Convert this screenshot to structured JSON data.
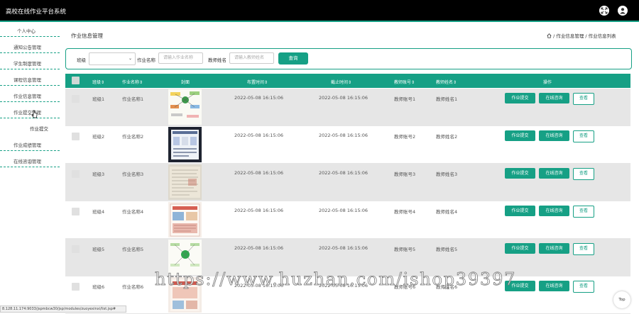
{
  "app": {
    "title": "高校在线作业平台系统"
  },
  "header": {
    "icons": [
      "expand-icon",
      "user-avatar-icon"
    ]
  },
  "sidebar": {
    "items": [
      {
        "label": "个人中心"
      },
      {
        "label": "通知公告管理"
      },
      {
        "label": "学生制度管理"
      },
      {
        "label": "课程信息管理"
      },
      {
        "label": "作业信息管理"
      },
      {
        "label": "作业提交管理"
      },
      {
        "label": "作业成绩管理"
      },
      {
        "label": "在线咨询管理"
      }
    ],
    "submenu": {
      "label": "作业提交"
    }
  },
  "page": {
    "title": "作业信息管理",
    "breadcrumb": "/ 作业信息管理 / 作业信息列表"
  },
  "search": {
    "class_label": "班级",
    "homework_label": "作业名称",
    "homework_placeholder": "请输入作业名称",
    "teacher_label": "教师姓名",
    "teacher_placeholder": "请输入教师姓名",
    "query_button": "查询"
  },
  "table": {
    "columns": [
      "班级⇕",
      "作业名称⇕",
      "封面",
      "布置时间⇕",
      "截止时间⇕",
      "教师账号⇕",
      "教师姓名⇕",
      "操作"
    ],
    "rows": [
      {
        "class": "班级1",
        "name": "作业名称1",
        "assign": "2022-05-08 16:15:06",
        "deadline": "2022-05-08 16:15:06",
        "account": "教师账号1",
        "teacher": "教师姓名1"
      },
      {
        "class": "班级2",
        "name": "作业名称2",
        "assign": "2022-05-08 16:15:06",
        "deadline": "2022-05-08 16:15:06",
        "account": "教师账号2",
        "teacher": "教师姓名2"
      },
      {
        "class": "班级3",
        "name": "作业名称3",
        "assign": "2022-05-08 16:15:06",
        "deadline": "2022-05-08 16:15:06",
        "account": "教师账号3",
        "teacher": "教师姓名3"
      },
      {
        "class": "班级4",
        "name": "作业名称4",
        "assign": "2022-05-08 16:15:06",
        "deadline": "2022-05-08 16:15:06",
        "account": "教师账号4",
        "teacher": "教师姓名4"
      },
      {
        "class": "班级5",
        "name": "作业名称5",
        "assign": "2022-05-08 16:15:06",
        "deadline": "2022-05-08 16:15:06",
        "account": "教师账号5",
        "teacher": "教师姓名5"
      },
      {
        "class": "班级6",
        "name": "作业名称6",
        "assign": "2022-05-08 16:15:06",
        "deadline": "2022-05-08 16:15:06",
        "account": "教师账号6",
        "teacher": "教师姓名6"
      }
    ],
    "actions": {
      "submit": "作业提交",
      "consult": "在线咨询",
      "view": "查看"
    }
  },
  "watermark": "https://www.huzhan.com/ishop39397",
  "statusbar": "8.128.11.174:9033/jspmbcw30/jsp/modules/zuoyexinxi/list.jsp#",
  "back_to_top": "Top",
  "colors": {
    "accent": "#16a085",
    "topbar": "#000000"
  }
}
